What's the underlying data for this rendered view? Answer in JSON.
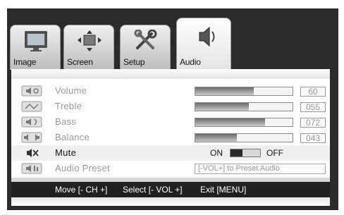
{
  "tabs": [
    {
      "label": "Image",
      "icon": "monitor-icon",
      "active": false
    },
    {
      "label": "Screen",
      "icon": "move-arrows-icon",
      "active": false
    },
    {
      "label": "Setup",
      "icon": "tools-icon",
      "active": false
    },
    {
      "label": "Audio",
      "icon": "speaker-icon",
      "active": true
    }
  ],
  "rows": [
    {
      "label": "Volume",
      "value": "60",
      "level": 60,
      "icon": "volume-icon"
    },
    {
      "label": "Treble",
      "value": "055",
      "level": 55,
      "icon": "treble-icon"
    },
    {
      "label": "Bass",
      "value": "072",
      "level": 72,
      "icon": "bass-icon"
    },
    {
      "label": "Balance",
      "value": "043",
      "level": 43,
      "icon": "balance-icon"
    }
  ],
  "mute": {
    "label": "Mute",
    "on_label": "ON",
    "off_label": "OFF",
    "icon": "mute-icon"
  },
  "preset": {
    "label": "Audio Preset",
    "value": "[-VOL+]  to Preset Audio",
    "icon": "audio-preset-icon"
  },
  "footer": {
    "move": "Move [- CH +]",
    "select": "Select [- VOL +]",
    "exit": "Exit [MENU]"
  },
  "colors": {
    "background": "#2b2b2b",
    "panel": "#ffffff",
    "footer": "#202020"
  }
}
